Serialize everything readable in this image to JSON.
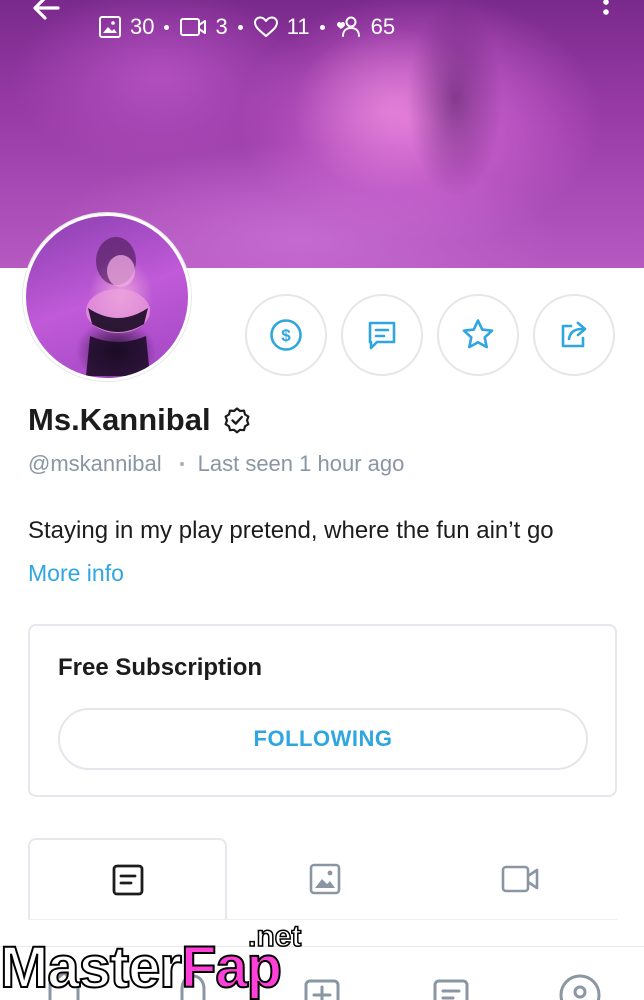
{
  "header": {
    "back_icon": "arrow-left-icon",
    "menu_icon": "more-vertical-icon",
    "stats": [
      {
        "icon": "image-icon",
        "value": "30"
      },
      {
        "icon": "video-icon",
        "value": "3"
      },
      {
        "icon": "heart-icon",
        "value": "11"
      },
      {
        "icon": "fans-icon",
        "value": "65"
      }
    ]
  },
  "profile": {
    "name": "Ms.Kannibal",
    "verified_icon": "verified-badge-icon",
    "handle": "@mskannibal",
    "last_seen": "Last seen 1 hour ago",
    "bio": "Staying in my play pretend, where the fun ain’t go",
    "more_info": "More info"
  },
  "actions": [
    {
      "name": "tip-button",
      "icon": "dollar-circle-icon"
    },
    {
      "name": "message-button",
      "icon": "message-icon"
    },
    {
      "name": "favorite-button",
      "icon": "star-icon"
    },
    {
      "name": "share-button",
      "icon": "share-icon"
    }
  ],
  "subscription": {
    "title": "Free Subscription",
    "button_label": "FOLLOWING"
  },
  "tabs": [
    {
      "name": "posts",
      "icon": "posts-icon",
      "active": true
    },
    {
      "name": "photos",
      "icon": "image-icon",
      "active": false
    },
    {
      "name": "videos",
      "icon": "video-icon",
      "active": false
    }
  ],
  "bottom_nav": [
    {
      "name": "home",
      "icon": "home-icon"
    },
    {
      "name": "notifications",
      "icon": "bell-icon"
    },
    {
      "name": "add-post",
      "icon": "plus-square-icon"
    },
    {
      "name": "messages",
      "icon": "message-icon"
    },
    {
      "name": "profile",
      "icon": "profile-icon"
    }
  ],
  "watermark": {
    "text_main": "Master",
    "text_accent": "Fap",
    "text_suffix": ".net"
  },
  "colors": {
    "accent": "#2fa6e0",
    "muted": "#8a96a3",
    "watermark_accent": "#ff40d8"
  }
}
